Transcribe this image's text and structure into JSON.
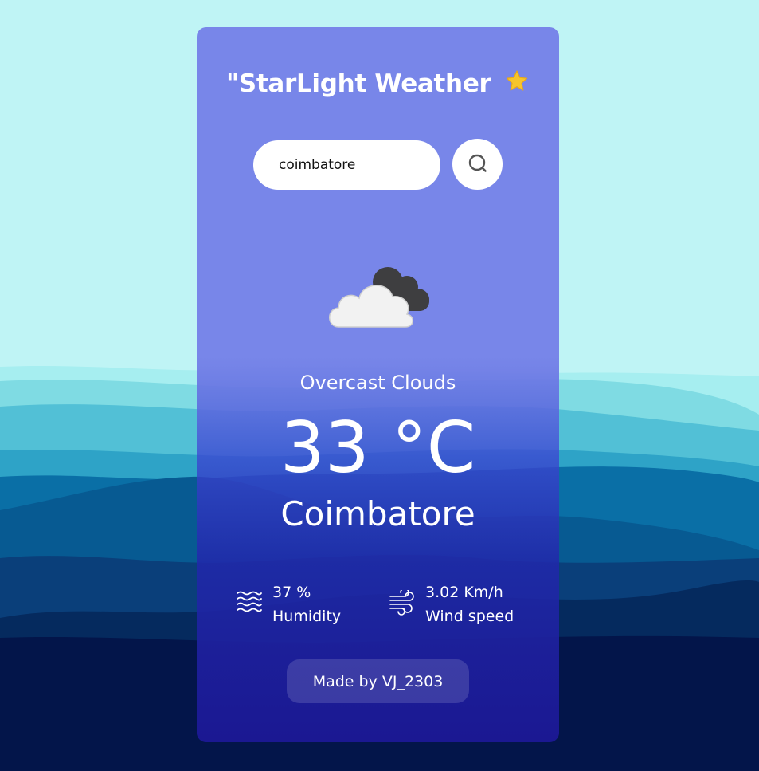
{
  "app": {
    "title": "\"StarLight Weather",
    "title_icon": "star-icon"
  },
  "search": {
    "value": "coimbatore",
    "placeholder": "",
    "button_icon": "search-icon"
  },
  "weather": {
    "icon": "overcast-clouds-icon",
    "condition": "Overcast Clouds",
    "temperature": "33 °C",
    "city": "Coimbatore"
  },
  "stats": {
    "humidity": {
      "value": "37 %",
      "label": "Humidity",
      "icon": "waves-icon"
    },
    "wind": {
      "value": "3.02 Km/h",
      "label": "Wind speed",
      "icon": "wind-icon"
    }
  },
  "footer": {
    "credit": "Made by VJ_2303"
  },
  "colors": {
    "sky": "#bff4f5",
    "card_top": "#7886e9",
    "card_bottom": "#1c1896",
    "mountain_dark": "#03154a",
    "star": "#f7c52b"
  }
}
